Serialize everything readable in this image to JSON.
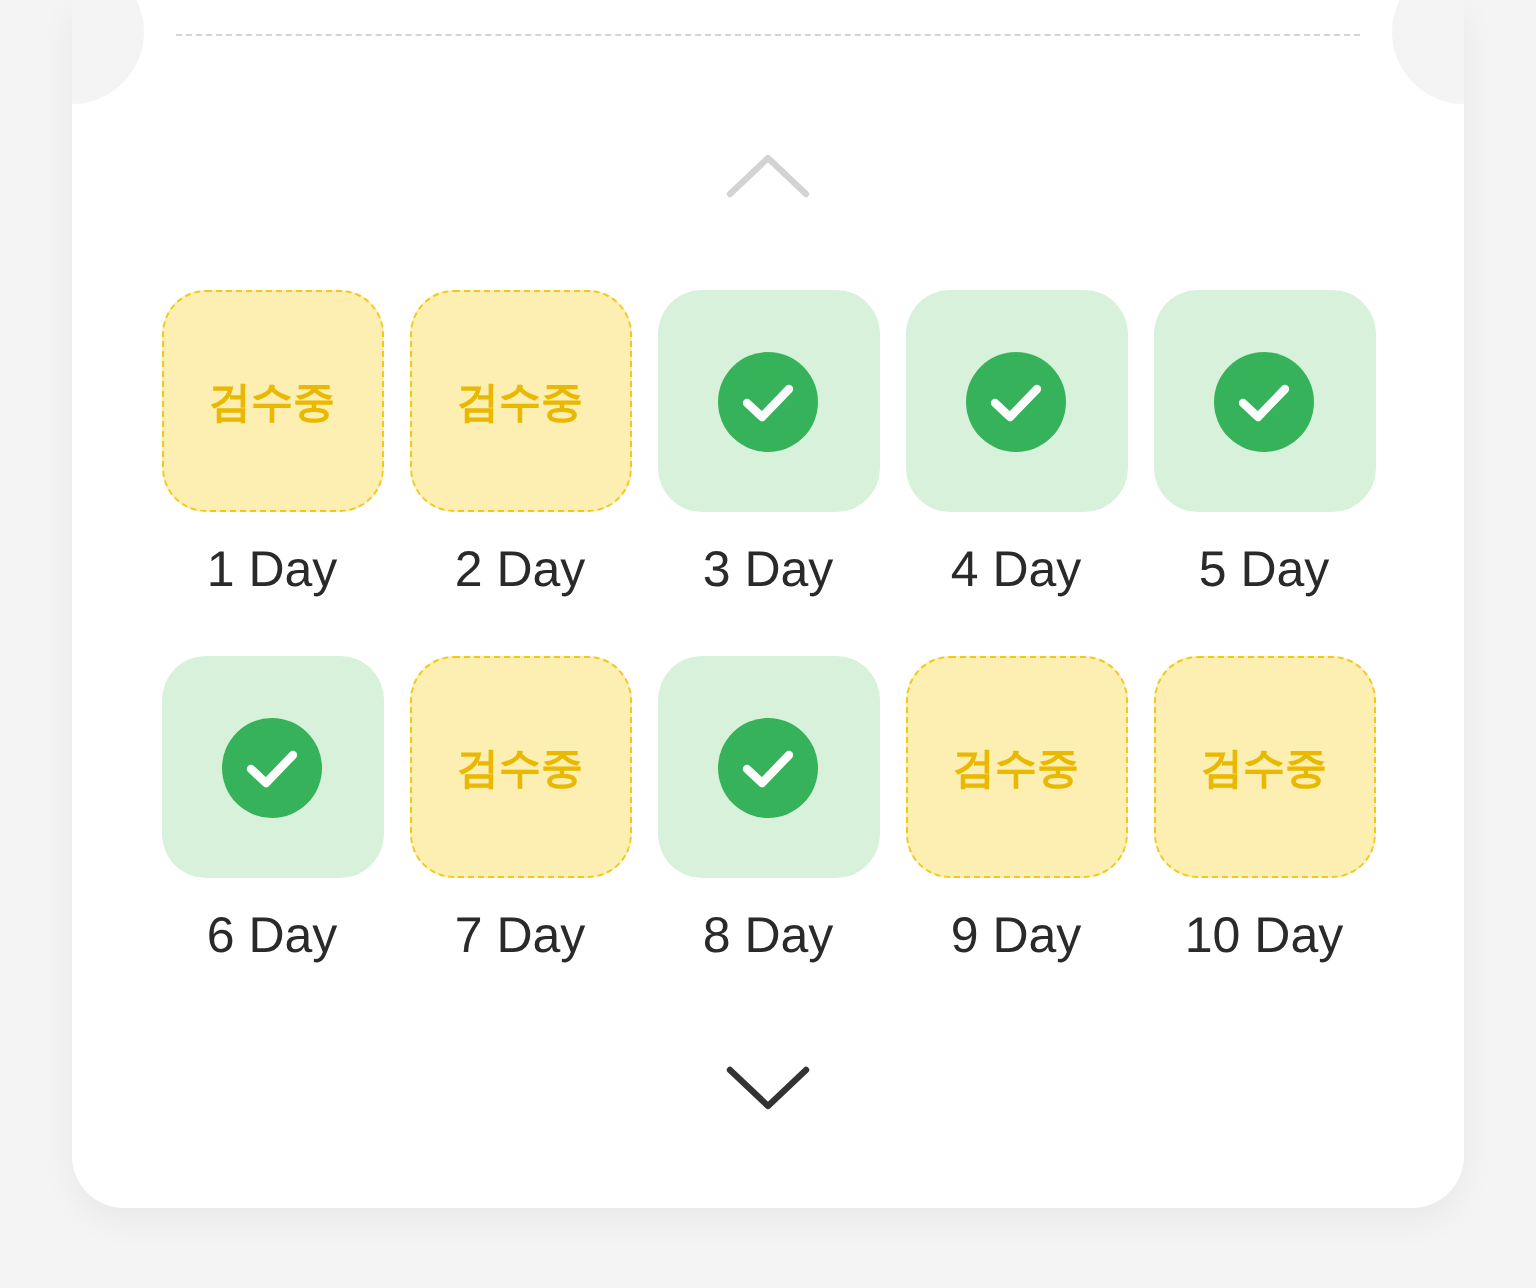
{
  "scroll_up": {
    "disabled": true
  },
  "days": [
    {
      "kind": "in_review",
      "badge": "검수중",
      "label": "1 Day"
    },
    {
      "kind": "in_review",
      "badge": "검수중",
      "label": "2 Day"
    },
    {
      "kind": "done",
      "label": "3 Day"
    },
    {
      "kind": "done",
      "label": "4 Day"
    },
    {
      "kind": "done",
      "label": "5 Day"
    },
    {
      "kind": "done",
      "label": "6 Day"
    },
    {
      "kind": "in_review",
      "badge": "검수중",
      "label": "7 Day"
    },
    {
      "kind": "done",
      "label": "8 Day"
    },
    {
      "kind": "in_review",
      "badge": "검수중",
      "label": "9 Day"
    },
    {
      "kind": "in_review",
      "badge": "검수중",
      "label": "10 Day"
    }
  ],
  "scroll_down": {
    "disabled": false
  }
}
